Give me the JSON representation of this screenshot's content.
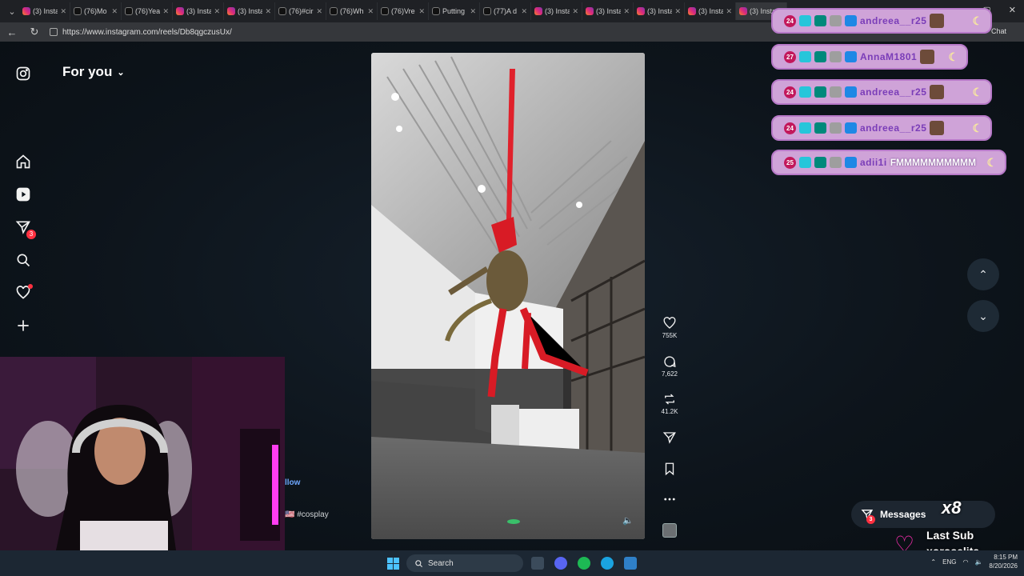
{
  "browser": {
    "tabs": [
      {
        "label": "(3) Insta",
        "kind": "ig"
      },
      {
        "label": "(76)Mo",
        "kind": "tt"
      },
      {
        "label": "(76)Yea",
        "kind": "tt"
      },
      {
        "label": "(3) Insta",
        "kind": "ig"
      },
      {
        "label": "(3) Insta",
        "kind": "ig"
      },
      {
        "label": "(76)#cir",
        "kind": "tt"
      },
      {
        "label": "(76)Wh",
        "kind": "tt"
      },
      {
        "label": "(76)Vre",
        "kind": "tt"
      },
      {
        "label": "Putting",
        "kind": "tt"
      },
      {
        "label": "(77)A d",
        "kind": "tt"
      },
      {
        "label": "(3) Insta",
        "kind": "ig"
      },
      {
        "label": "(3) Insta",
        "kind": "ig"
      },
      {
        "label": "(3) Insta",
        "kind": "ig"
      },
      {
        "label": "(3) Insta",
        "kind": "ig"
      },
      {
        "label": "(3) Insta",
        "kind": "ig"
      }
    ],
    "url": "https://www.instagram.com/reels/Db8qgczusUx/",
    "chat_label": "Chat"
  },
  "feed": {
    "title": "For you",
    "sidebar_badges": {
      "messages": "3"
    }
  },
  "reel": {
    "likes": "755K",
    "comments": "7,622",
    "reposts": "41.2K",
    "follow_label": "llow",
    "tag": "🇺🇸 #cosplay"
  },
  "messages_button": {
    "label": "Messages",
    "badge": "3"
  },
  "chat_overlay": [
    {
      "level": "24",
      "user": "andreea__r25",
      "msg": ""
    },
    {
      "level": "27",
      "user": "AnnaM1801",
      "msg": ""
    },
    {
      "level": "24",
      "user": "andreea__r25",
      "msg": ""
    },
    {
      "level": "24",
      "user": "andreea__r25",
      "msg": ""
    },
    {
      "level": "25",
      "user": "adii1i",
      "msg": "FMMMMMMMMMM"
    }
  ],
  "stream_overlay": {
    "x_count": "x8",
    "last_sub_label": "Last Sub",
    "last_sub_user": "xoroselita"
  },
  "taskbar": {
    "search_label": "Search",
    "lang": "ENG",
    "time": "8:15 PM",
    "date": "8/20/2026"
  },
  "colors": {
    "accent_pink": "#ff2fb4",
    "notification_red": "#ff3040",
    "chat_bubble": "#cfa3d8",
    "chat_username": "#7a3db8"
  }
}
